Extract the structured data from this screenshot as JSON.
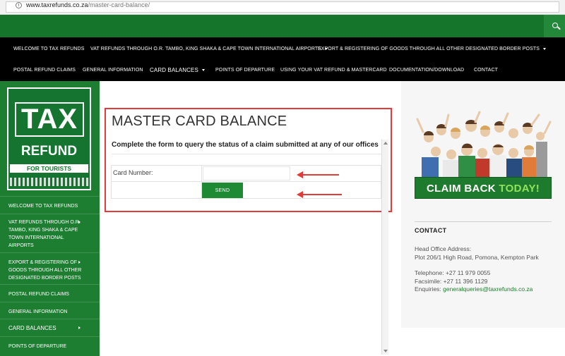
{
  "browser": {
    "url_host": "www.taxrefunds.co.za",
    "url_path": "/master-card-balance/"
  },
  "nav": {
    "row1": [
      {
        "label": "WELCOME TO TAX REFUNDS",
        "has_submenu": false
      },
      {
        "label": "VAT REFUNDS THROUGH O.R. TAMBO, KING SHAKA & CAPE TOWN INTERNATIONAL AIRPORTS",
        "has_submenu": true
      },
      {
        "label": "EXPORT & REGISTERING OF GOODS THROUGH ALL OTHER DESIGNATED BORDER POSTS",
        "has_submenu": true
      }
    ],
    "row2": [
      {
        "label": "POSTAL REFUND CLAIMS",
        "has_submenu": false
      },
      {
        "label": "GENERAL INFORMATION",
        "has_submenu": false
      },
      {
        "label": "CARD BALANCES",
        "has_submenu": true
      },
      {
        "label": "POINTS OF DEPARTURE",
        "has_submenu": false
      },
      {
        "label": "USING YOUR VAT REFUND & MASTERCARD",
        "has_submenu": false
      },
      {
        "label": "DOCUMENTATION/DOWNLOAD",
        "has_submenu": false
      },
      {
        "label": "CONTACT",
        "has_submenu": false
      }
    ]
  },
  "logo": {
    "line1": "TAX",
    "line2": "REFUND",
    "line3": "FOR TOURISTS"
  },
  "sidebar": {
    "items": [
      {
        "label": "WELCOME TO TAX REFUNDS"
      },
      {
        "label": "VAT REFUNDS THROUGH O.R.\nTAMBO, KING SHAKA & CAPE\nTOWN INTERNATIONAL\nAIRPORTS"
      },
      {
        "label": "EXPORT & REGISTERING OF\nGOODS THROUGH ALL OTHER\nDESIGNATED BORDER POSTS"
      },
      {
        "label": "POSTAL REFUND CLAIMS"
      },
      {
        "label": "GENERAL INFORMATION"
      },
      {
        "label": "CARD BALANCES"
      },
      {
        "label": "POINTS OF DEPARTURE"
      }
    ]
  },
  "main": {
    "title": "MASTER CARD BALANCE",
    "description": "Complete the form to query the status of a claim submitted at any of our offices",
    "card_number_label": "Card Number:",
    "card_number_value": "",
    "send_label": "SEND"
  },
  "promo": {
    "claim": "CLAIM BACK",
    "today": "TODAY!"
  },
  "contact": {
    "heading": "CONTACT",
    "address_label": "Head Office Address:",
    "address": "Plot 206/1 High Road, Pomona, Kempton Park",
    "telephone": "Telephone: +27 11 979 0055",
    "facsimile": "Facsimile: +27 11 396 1129",
    "enquiries_label": "Enquiries: ",
    "enquiries_email": "generalqueries@taxrefunds.co.za"
  },
  "colors": {
    "brand_green": "#15762b",
    "highlight_red": "#e33b3b"
  }
}
